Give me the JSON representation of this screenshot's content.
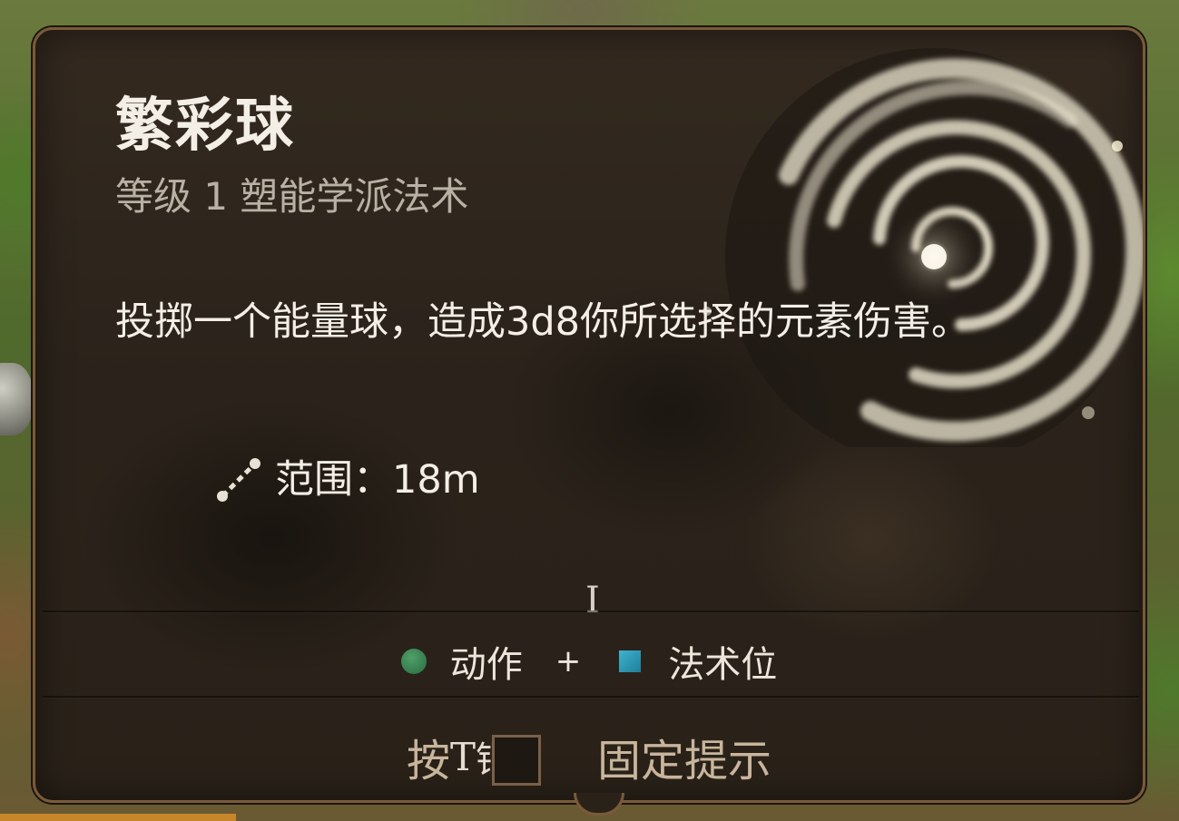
{
  "spell": {
    "name": "繁彩球",
    "subtitle": "等级 1 塑能学派法术",
    "description": "投掷一个能量球，造成3d8你所选择的元素伤害。",
    "range_label": "范围：",
    "range_value": "18m"
  },
  "cursor": "I",
  "cost": {
    "action_label": "动作",
    "plus": "+",
    "slot_label": "法术位",
    "action_color": "#3a8a55",
    "slot_color": "#2a9ab8"
  },
  "hint": {
    "prefix": "按",
    "key": "T",
    "mid": "销",
    "suffix": "固定提示"
  },
  "icons": {
    "range": "range-dotted-line-icon",
    "action": "action-circle-icon",
    "spell_slot": "spell-slot-square-icon"
  },
  "colors": {
    "panel_border": "#7a5a3a",
    "title_text": "#f4efe6",
    "subtitle_text": "#b9b1a4",
    "hint_text": "#c8b59c"
  }
}
